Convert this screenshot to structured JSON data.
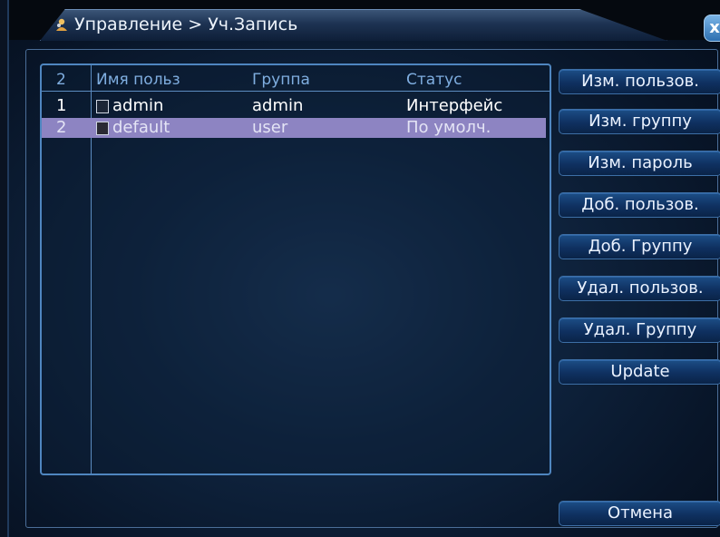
{
  "window": {
    "title": "Управление > Уч.Запись",
    "close_label": "x"
  },
  "table": {
    "header": {
      "count": "2",
      "user": "Имя польз",
      "group": "Группа",
      "status": "Статус"
    },
    "rows": [
      {
        "index": "1",
        "user": "admin",
        "group": "admin",
        "status": "Интерфейс",
        "selected": false
      },
      {
        "index": "2",
        "user": "default",
        "group": "user",
        "status": "По умолч.",
        "selected": true
      }
    ]
  },
  "buttons": {
    "modify_user": "Изм. пользов.",
    "modify_group": "Изм. группу",
    "modify_password": "Изм. пароль",
    "add_user": "Доб. пользов.",
    "add_group": "Доб. Группу",
    "delete_user": "Удал. пользов.",
    "delete_group": "Удал. Группу",
    "update": "Update",
    "cancel": "Отмена"
  },
  "colors": {
    "accent": "#4f86c0",
    "selected_row": "#8d84c2",
    "header_text": "#7faee0"
  }
}
